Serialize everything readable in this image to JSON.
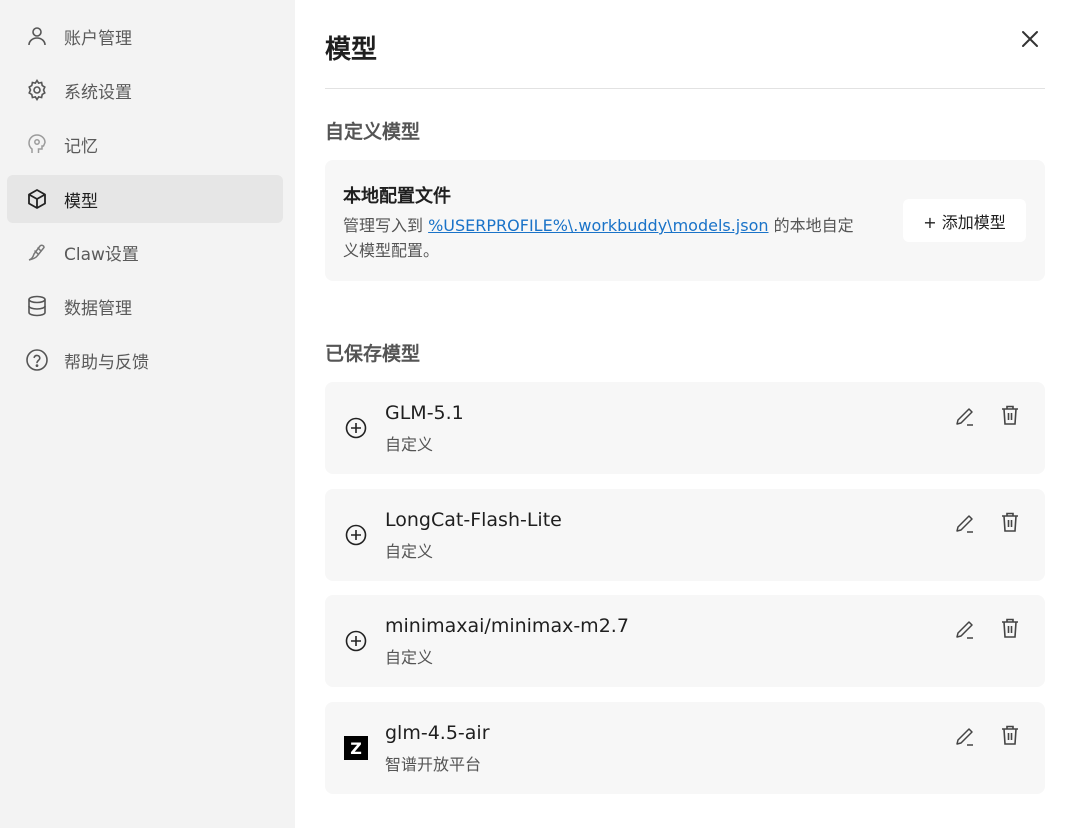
{
  "sidebar": {
    "items": [
      {
        "label": "账户管理",
        "icon": "user-icon"
      },
      {
        "label": "系统设置",
        "icon": "gear-icon"
      },
      {
        "label": "记忆",
        "icon": "memory-head-icon"
      },
      {
        "label": "模型",
        "icon": "cube-icon",
        "active": true
      },
      {
        "label": "Claw设置",
        "icon": "claw-icon"
      },
      {
        "label": "数据管理",
        "icon": "database-icon"
      },
      {
        "label": "帮助与反馈",
        "icon": "help-icon"
      }
    ]
  },
  "main": {
    "title": "模型",
    "close_icon": "close-icon",
    "custom_section": {
      "title": "自定义模型",
      "card_title": "本地配置文件",
      "desc_prefix": "管理写入到 ",
      "desc_link": "%USERPROFILE%\\.workbuddy\\models.json",
      "desc_suffix": " 的本地自定义模型配置。",
      "add_button": "+ 添加模型"
    },
    "saved_section": {
      "title": "已保存模型",
      "models": [
        {
          "name": "GLM-5.1",
          "provider": "自定义",
          "icon": "plus-circle-icon"
        },
        {
          "name": "LongCat-Flash-Lite",
          "provider": "自定义",
          "icon": "plus-circle-icon"
        },
        {
          "name": "minimaxai/minimax-m2.7",
          "provider": "自定义",
          "icon": "plus-circle-icon"
        },
        {
          "name": "glm-4.5-air",
          "provider": "智谱开放平台",
          "icon": "zhipu-logo-icon",
          "logo_letter": "Z"
        }
      ]
    }
  },
  "colors": {
    "sidebar_bg": "#f3f3f3",
    "active_item_bg": "#e6e6e6",
    "card_bg": "#f7f7f7",
    "link": "#1a73c8"
  }
}
